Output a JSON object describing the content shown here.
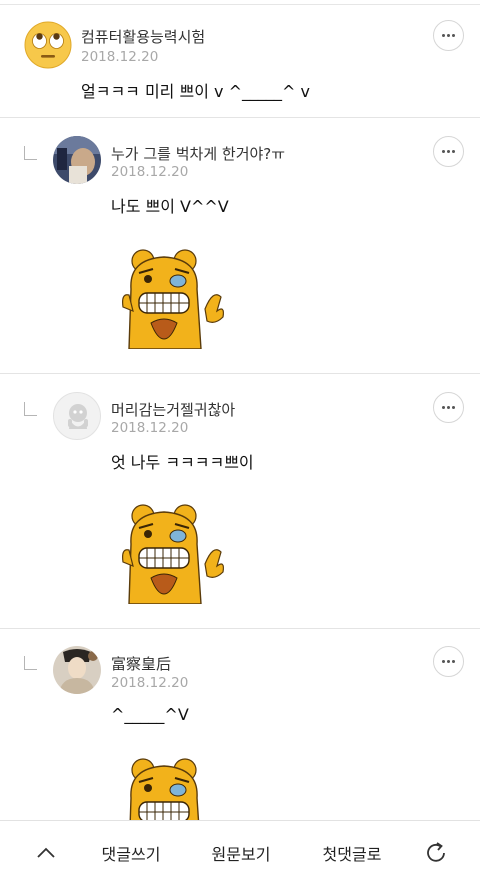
{
  "comments": [
    {
      "name": "컴퓨터활용능력시험",
      "date": "2018.12.20",
      "text": "얼ㅋㅋㅋ 미리 쁘이 v ^_____^ v",
      "avatar_icon": "rolling-eyes-emoji-icon",
      "is_reply": false,
      "has_sticker": false
    },
    {
      "name": "누가 그를 벅차게 한거야?ㅠ",
      "date": "2018.12.20",
      "text": "나도 쁘이 V^^V",
      "avatar_icon": "photo-avatar-icon",
      "is_reply": true,
      "has_sticker": true
    },
    {
      "name": "머리감는거젤귀찮아",
      "date": "2018.12.20",
      "text": "엇 나두 ㅋㅋㅋㅋ쁘이",
      "avatar_icon": "default-avatar-icon",
      "is_reply": true,
      "has_sticker": true
    },
    {
      "name": "富察皇后",
      "date": "2018.12.20",
      "text": "^_____^V",
      "avatar_icon": "portrait-avatar-icon",
      "is_reply": true,
      "has_sticker": true
    }
  ],
  "bottom_bar": {
    "scroll_top_icon": "chevron-up-icon",
    "write_comment": "댓글쓰기",
    "view_original": "원문보기",
    "first_comment": "첫댓글로",
    "refresh_icon": "refresh-icon"
  },
  "colors": {
    "text": "#111111",
    "date": "#a8a8a8",
    "divider": "#e4e4e4",
    "sticker_yellow": "#f2b21b"
  }
}
